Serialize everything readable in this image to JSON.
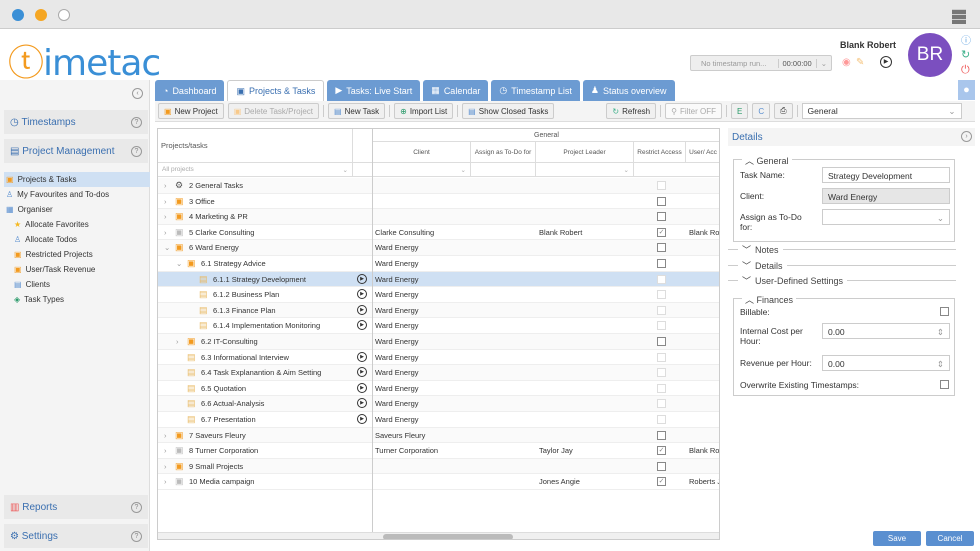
{
  "app": {
    "logo_text": "timetac",
    "user_name": "Blank Robert",
    "avatar_initials": "BR",
    "timestamp_status": "No timestamp run...",
    "timer": "00:00:00"
  },
  "sidebar": {
    "timestamps": "Timestamps",
    "project_management": "Project Management",
    "reports": "Reports",
    "settings": "Settings",
    "tree": [
      {
        "label": "Projects & Tasks",
        "level": 0,
        "selected": true,
        "icon": "folder-icon"
      },
      {
        "label": "My Favourites and To-dos",
        "level": 0,
        "icon": "user-icon"
      },
      {
        "label": "Organiser",
        "level": 0,
        "icon": "folder-tree-icon"
      },
      {
        "label": "Allocate Favorites",
        "level": 1,
        "icon": "star-icon"
      },
      {
        "label": "Allocate Todos",
        "level": 1,
        "icon": "user-icon"
      },
      {
        "label": "Restricted Projects",
        "level": 1,
        "icon": "folder-icon"
      },
      {
        "label": "User/Task Revenue",
        "level": 1,
        "icon": "folder-icon"
      },
      {
        "label": "Clients",
        "level": 1,
        "icon": "clients-icon"
      },
      {
        "label": "Task Types",
        "level": 1,
        "icon": "tag-icon"
      }
    ]
  },
  "tabs": [
    {
      "label": "Dashboard",
      "active": false
    },
    {
      "label": "Projects & Tasks",
      "active": true
    },
    {
      "label": "Tasks: Live Start",
      "active": false
    },
    {
      "label": "Calendar",
      "active": false
    },
    {
      "label": "Timestamp List",
      "active": false
    },
    {
      "label": "Status overview",
      "active": false
    }
  ],
  "toolbar": {
    "new_project": "New Project",
    "delete": "Delete Task/Project",
    "new_task": "New Task",
    "import_list": "Import List",
    "show_closed": "Show Closed Tasks",
    "refresh": "Refresh",
    "filter": "Filter OFF",
    "view_select": "General"
  },
  "grid": {
    "col_tree": "Projects/tasks",
    "group_general": "General",
    "col_client": "Client",
    "col_assign": "Assign as To-Do for",
    "col_leader": "Project Leader",
    "col_restrict": "Restrict Access",
    "col_user": "User/ Acc",
    "filter_placeholder": "All projects",
    "rows": [
      {
        "label": "2 General Tasks",
        "level": 0,
        "exp": ">",
        "icon": "gear",
        "play": false,
        "client": "",
        "leader": "",
        "restrict": "dis",
        "user": ""
      },
      {
        "label": "3 Office",
        "level": 0,
        "exp": ">",
        "icon": "folder",
        "play": false,
        "client": "",
        "leader": "",
        "restrict": "off",
        "user": ""
      },
      {
        "label": "4 Marketing & PR",
        "level": 0,
        "exp": ">",
        "icon": "folder",
        "play": false,
        "client": "",
        "leader": "",
        "restrict": "off",
        "user": ""
      },
      {
        "label": "5 Clarke Consulting",
        "level": 0,
        "exp": ">",
        "icon": "folder-gray",
        "play": false,
        "client": "Clarke Consulting",
        "leader": "Blank Robert",
        "restrict": "on",
        "user": "Blank Rob"
      },
      {
        "label": "6 Ward Energy",
        "level": 0,
        "exp": "v",
        "icon": "folder",
        "play": false,
        "client": "Ward Energy",
        "leader": "",
        "restrict": "off",
        "user": ""
      },
      {
        "label": "6.1 Strategy Advice",
        "level": 1,
        "exp": "v",
        "icon": "folder",
        "play": false,
        "client": "Ward Energy",
        "leader": "",
        "restrict": "off",
        "user": ""
      },
      {
        "label": "6.1.1 Strategy Development",
        "level": 2,
        "exp": "",
        "icon": "task",
        "play": true,
        "client": "Ward Energy",
        "leader": "",
        "restrict": "dis",
        "user": "",
        "selected": true
      },
      {
        "label": "6.1.2 Business Plan",
        "level": 2,
        "exp": "",
        "icon": "task",
        "play": true,
        "client": "Ward Energy",
        "leader": "",
        "restrict": "dis",
        "user": ""
      },
      {
        "label": "6.1.3 Finance Plan",
        "level": 2,
        "exp": "",
        "icon": "task",
        "play": true,
        "client": "Ward Energy",
        "leader": "",
        "restrict": "dis",
        "user": ""
      },
      {
        "label": "6.1.4 Implementation Monitoring",
        "level": 2,
        "exp": "",
        "icon": "task",
        "play": true,
        "client": "Ward Energy",
        "leader": "",
        "restrict": "dis",
        "user": ""
      },
      {
        "label": "6.2 IT-Consulting",
        "level": 1,
        "exp": ">",
        "icon": "folder",
        "play": false,
        "client": "Ward Energy",
        "leader": "",
        "restrict": "off",
        "user": ""
      },
      {
        "label": "6.3 Informational Interview",
        "level": 1,
        "exp": "",
        "icon": "task",
        "play": true,
        "client": "Ward Energy",
        "leader": "",
        "restrict": "dis",
        "user": ""
      },
      {
        "label": "6.4 Task Explanantion & Aim Setting",
        "level": 1,
        "exp": "",
        "icon": "task",
        "play": true,
        "client": "Ward Energy",
        "leader": "",
        "restrict": "dis",
        "user": ""
      },
      {
        "label": "6.5 Quotation",
        "level": 1,
        "exp": "",
        "icon": "task",
        "play": true,
        "client": "Ward Energy",
        "leader": "",
        "restrict": "dis",
        "user": ""
      },
      {
        "label": "6.6 Actual-Analysis",
        "level": 1,
        "exp": "",
        "icon": "task",
        "play": true,
        "client": "Ward Energy",
        "leader": "",
        "restrict": "dis",
        "user": ""
      },
      {
        "label": "6.7 Presentation",
        "level": 1,
        "exp": "",
        "icon": "task",
        "play": true,
        "client": "Ward Energy",
        "leader": "",
        "restrict": "dis",
        "user": ""
      },
      {
        "label": "7 Saveurs Fleury",
        "level": 0,
        "exp": ">",
        "icon": "folder",
        "play": false,
        "client": "Saveurs Fleury",
        "leader": "",
        "restrict": "off",
        "user": ""
      },
      {
        "label": "8 Turner Corporation",
        "level": 0,
        "exp": ">",
        "icon": "folder-gray",
        "play": false,
        "client": "Turner Corporation",
        "leader": "Taylor Jay",
        "restrict": "on",
        "user": "Blank Rob"
      },
      {
        "label": "9 Small Projects",
        "level": 0,
        "exp": ">",
        "icon": "folder",
        "play": false,
        "client": "",
        "leader": "",
        "restrict": "off",
        "user": ""
      },
      {
        "label": "10 Media campaign",
        "level": 0,
        "exp": ">",
        "icon": "folder-gray",
        "play": false,
        "client": "",
        "leader": "Jones Angie",
        "restrict": "on",
        "user": "Roberts Ji"
      }
    ]
  },
  "details": {
    "title": "Details",
    "general": "General",
    "task_name_label": "Task Name:",
    "task_name": "Strategy Development",
    "client_label": "Client:",
    "client": "Ward Energy",
    "assign_label": "Assign as To-Do for:",
    "notes": "Notes",
    "details": "Details",
    "user_defined": "User-Defined Settings",
    "finances": "Finances",
    "billable_label": "Billable:",
    "internal_cost_label": "Internal Cost per Hour:",
    "internal_cost": "0.00",
    "revenue_label": "Revenue per Hour:",
    "revenue": "0.00",
    "overwrite_label": "Overwrite Existing Timestamps:",
    "save": "Save",
    "cancel": "Cancel"
  },
  "colors": {
    "accent": "#3a6fb0",
    "tab": "#6c9bd2",
    "avatar": "#7b4fbf",
    "orange": "#f39a1e"
  }
}
